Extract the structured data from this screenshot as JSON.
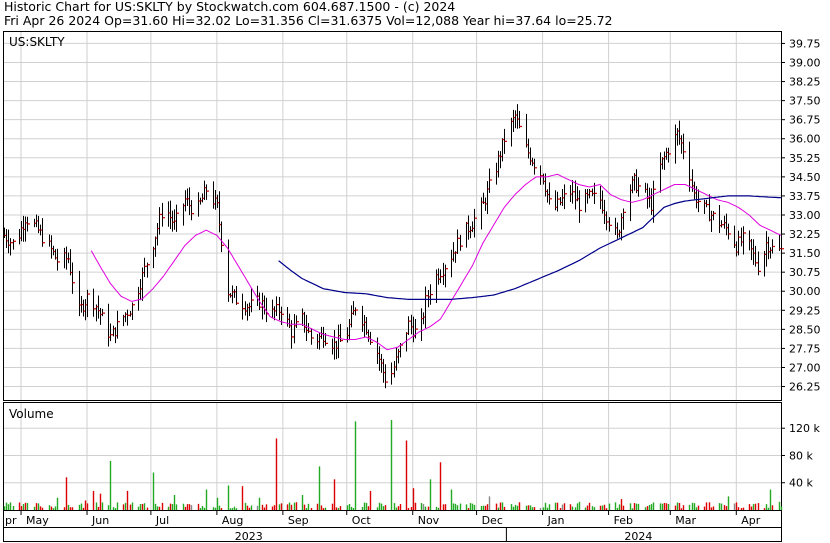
{
  "header": {
    "line1": "Historic Chart for US:SKLTY by Stockwatch.com 604.687.1500 - (c) 2024",
    "line2": "Fri Apr 26 2024   Op=31.60  Hi=32.02  Lo=31.356  Cl=31.6375  Vol=12,088   Year hi=37.64  lo=25.72"
  },
  "chart_data": [
    {
      "type": "line",
      "title": "US:SKLTY",
      "y_ticks": [
        "39.75",
        "39.00",
        "38.25",
        "37.50",
        "36.75",
        "36.00",
        "35.25",
        "34.50",
        "33.75",
        "33.00",
        "32.25",
        "31.50",
        "30.75",
        "30.00",
        "29.25",
        "28.50",
        "27.75",
        "27.00",
        "26.25"
      ],
      "ylim": [
        25.72,
        40.2
      ],
      "x_months": [
        {
          "label": "pr",
          "day": 0
        },
        {
          "label": "May",
          "day": 8
        },
        {
          "label": "Jun",
          "day": 39
        },
        {
          "label": "Jul",
          "day": 69
        },
        {
          "label": "Aug",
          "day": 100
        },
        {
          "label": "Sep",
          "day": 131
        },
        {
          "label": "Oct",
          "day": 161
        },
        {
          "label": "Nov",
          "day": 192
        },
        {
          "label": "Dec",
          "day": 222
        },
        {
          "label": "Jan",
          "day": 253
        },
        {
          "label": "Feb",
          "day": 284
        },
        {
          "label": "Mar",
          "day": 313
        },
        {
          "label": "Apr",
          "day": 344
        }
      ],
      "x_years": [
        {
          "label": "2023",
          "day": 115
        },
        {
          "label": "2024",
          "day": 298
        }
      ],
      "year_divider_day": 236,
      "x_days": 365,
      "price_anchors": [
        [
          0,
          32.2
        ],
        [
          5,
          31.8
        ],
        [
          10,
          32.9
        ],
        [
          15,
          32.5
        ],
        [
          20,
          31.9
        ],
        [
          25,
          31.2
        ],
        [
          30,
          31.3
        ],
        [
          35,
          29.2
        ],
        [
          40,
          29.9
        ],
        [
          45,
          29.1
        ],
        [
          50,
          28.2
        ],
        [
          55,
          28.9
        ],
        [
          60,
          29.4
        ],
        [
          65,
          30.6
        ],
        [
          70,
          31.9
        ],
        [
          75,
          33.4
        ],
        [
          80,
          32.6
        ],
        [
          85,
          33.6
        ],
        [
          90,
          33.1
        ],
        [
          95,
          34.0
        ],
        [
          100,
          33.3
        ],
        [
          103,
          31.4
        ],
        [
          105,
          30.0
        ],
        [
          110,
          29.6
        ],
        [
          115,
          29.4
        ],
        [
          120,
          29.6
        ],
        [
          125,
          29.1
        ],
        [
          130,
          29.3
        ],
        [
          135,
          28.4
        ],
        [
          140,
          28.9
        ],
        [
          145,
          28.0
        ],
        [
          150,
          28.3
        ],
        [
          155,
          27.9
        ],
        [
          160,
          28.1
        ],
        [
          165,
          29.4
        ],
        [
          170,
          28.6
        ],
        [
          175,
          27.6
        ],
        [
          180,
          26.3
        ],
        [
          185,
          27.5
        ],
        [
          190,
          28.7
        ],
        [
          195,
          28.2
        ],
        [
          198,
          29.6
        ],
        [
          202,
          30.5
        ],
        [
          206,
          30.9
        ],
        [
          210,
          31.4
        ],
        [
          215,
          32.2
        ],
        [
          220,
          32.7
        ],
        [
          225,
          33.4
        ],
        [
          230,
          34.6
        ],
        [
          235,
          36.0
        ],
        [
          240,
          36.9
        ],
        [
          245,
          35.6
        ],
        [
          250,
          34.9
        ],
        [
          253,
          34.5
        ],
        [
          257,
          33.1
        ],
        [
          262,
          33.6
        ],
        [
          266,
          33.9
        ],
        [
          270,
          33.4
        ],
        [
          275,
          33.7
        ],
        [
          280,
          33.6
        ],
        [
          284,
          32.8
        ],
        [
          288,
          32.1
        ],
        [
          292,
          33.8
        ],
        [
          296,
          34.3
        ],
        [
          300,
          33.9
        ],
        [
          304,
          33.4
        ],
        [
          308,
          34.9
        ],
        [
          312,
          35.6
        ],
        [
          316,
          36.2
        ],
        [
          320,
          35.4
        ],
        [
          324,
          33.8
        ],
        [
          328,
          33.3
        ],
        [
          332,
          33.0
        ],
        [
          336,
          32.7
        ],
        [
          340,
          32.4
        ],
        [
          344,
          31.8
        ],
        [
          348,
          32.1
        ],
        [
          352,
          31.4
        ],
        [
          355,
          30.8
        ],
        [
          358,
          31.9
        ],
        [
          362,
          31.6
        ],
        [
          365,
          31.6
        ]
      ],
      "ma_short_anchors": [
        [
          41,
          31.6
        ],
        [
          45,
          31.0
        ],
        [
          50,
          30.3
        ],
        [
          55,
          29.8
        ],
        [
          60,
          29.6
        ],
        [
          65,
          29.7
        ],
        [
          70,
          30.1
        ],
        [
          75,
          30.6
        ],
        [
          80,
          31.2
        ],
        [
          85,
          31.8
        ],
        [
          90,
          32.2
        ],
        [
          95,
          32.4
        ],
        [
          100,
          32.2
        ],
        [
          105,
          31.7
        ],
        [
          110,
          31.0
        ],
        [
          115,
          30.3
        ],
        [
          120,
          29.6
        ],
        [
          125,
          29.0
        ],
        [
          130,
          28.8
        ],
        [
          135,
          28.7
        ],
        [
          140,
          28.7
        ],
        [
          145,
          28.5
        ],
        [
          150,
          28.3
        ],
        [
          155,
          28.2
        ],
        [
          160,
          28.1
        ],
        [
          165,
          28.1
        ],
        [
          170,
          28.2
        ],
        [
          175,
          28.0
        ],
        [
          180,
          27.7
        ],
        [
          185,
          27.8
        ],
        [
          190,
          28.1
        ],
        [
          195,
          28.4
        ],
        [
          200,
          28.6
        ],
        [
          205,
          28.9
        ],
        [
          210,
          29.6
        ],
        [
          215,
          30.3
        ],
        [
          220,
          31.0
        ],
        [
          225,
          31.9
        ],
        [
          230,
          32.6
        ],
        [
          235,
          33.3
        ],
        [
          240,
          33.8
        ],
        [
          245,
          34.2
        ],
        [
          250,
          34.5
        ],
        [
          255,
          34.5
        ],
        [
          260,
          34.6
        ],
        [
          265,
          34.4
        ],
        [
          270,
          34.2
        ],
        [
          275,
          34.1
        ],
        [
          280,
          34.2
        ],
        [
          285,
          33.8
        ],
        [
          290,
          33.6
        ],
        [
          295,
          33.5
        ],
        [
          300,
          33.6
        ],
        [
          305,
          33.8
        ],
        [
          310,
          34.0
        ],
        [
          315,
          34.2
        ],
        [
          320,
          34.2
        ],
        [
          325,
          34.0
        ],
        [
          330,
          33.8
        ],
        [
          335,
          33.6
        ],
        [
          340,
          33.5
        ],
        [
          345,
          33.3
        ],
        [
          350,
          33.0
        ],
        [
          355,
          32.6
        ],
        [
          360,
          32.4
        ],
        [
          365,
          32.2
        ]
      ],
      "ma_long_anchors": [
        [
          129,
          31.2
        ],
        [
          135,
          30.8
        ],
        [
          140,
          30.5
        ],
        [
          145,
          30.3
        ],
        [
          150,
          30.1
        ],
        [
          160,
          29.95
        ],
        [
          170,
          29.9
        ],
        [
          180,
          29.75
        ],
        [
          190,
          29.68
        ],
        [
          200,
          29.68
        ],
        [
          210,
          29.68
        ],
        [
          220,
          29.75
        ],
        [
          230,
          29.85
        ],
        [
          240,
          30.1
        ],
        [
          250,
          30.45
        ],
        [
          260,
          30.8
        ],
        [
          270,
          31.2
        ],
        [
          280,
          31.7
        ],
        [
          290,
          32.1
        ],
        [
          300,
          32.5
        ],
        [
          305,
          32.9
        ],
        [
          310,
          33.3
        ],
        [
          315,
          33.45
        ],
        [
          320,
          33.55
        ],
        [
          330,
          33.65
        ],
        [
          340,
          33.75
        ],
        [
          350,
          33.75
        ],
        [
          360,
          33.7
        ],
        [
          365,
          33.68
        ]
      ],
      "colors": {
        "price": "#000000",
        "ma_short": "#e000e0",
        "ma_long": "#00008b",
        "close_tick": "#cc0000",
        "grid": "#d0d0d0"
      }
    },
    {
      "type": "bar",
      "title": "Volume",
      "y_ticks": [
        "120 k",
        "80 k",
        "40 k"
      ],
      "y_tick_values": [
        120000,
        80000,
        40000
      ],
      "ylim": [
        0,
        157000
      ],
      "spikes": [
        [
          25,
          18000
        ],
        [
          29,
          48000
        ],
        [
          38,
          14000
        ],
        [
          42,
          28000
        ],
        [
          45,
          24000
        ],
        [
          50,
          72000
        ],
        [
          58,
          28000
        ],
        [
          62,
          12000
        ],
        [
          70,
          55000
        ],
        [
          80,
          22000
        ],
        [
          90,
          55000
        ],
        [
          95,
          30000
        ],
        [
          100,
          18000
        ],
        [
          105,
          36000
        ],
        [
          112,
          35000
        ],
        [
          120,
          18000
        ],
        [
          128,
          105000
        ],
        [
          140,
          22000
        ],
        [
          148,
          64000
        ],
        [
          152,
          55000
        ],
        [
          155,
          45000
        ],
        [
          160,
          22000
        ],
        [
          165,
          130000
        ],
        [
          172,
          28000
        ],
        [
          180,
          28000
        ],
        [
          182,
          132000
        ],
        [
          187,
          66000
        ],
        [
          189,
          102000
        ],
        [
          192,
          32000
        ],
        [
          195,
          28000
        ],
        [
          200,
          45000
        ],
        [
          205,
          70000
        ],
        [
          210,
          30000
        ],
        [
          215,
          10000
        ],
        [
          228,
          20000
        ],
        [
          250,
          15000
        ],
        [
          258,
          20000
        ],
        [
          270,
          12000
        ],
        [
          290,
          16000
        ],
        [
          300,
          18000
        ],
        [
          320,
          12000
        ],
        [
          335,
          55000
        ],
        [
          340,
          20000
        ],
        [
          355,
          22000
        ],
        [
          360,
          30000
        ],
        [
          364,
          12000
        ]
      ],
      "colors": {
        "up": "#22aa22",
        "down": "#dd0000",
        "neutral": "#888888"
      }
    }
  ]
}
